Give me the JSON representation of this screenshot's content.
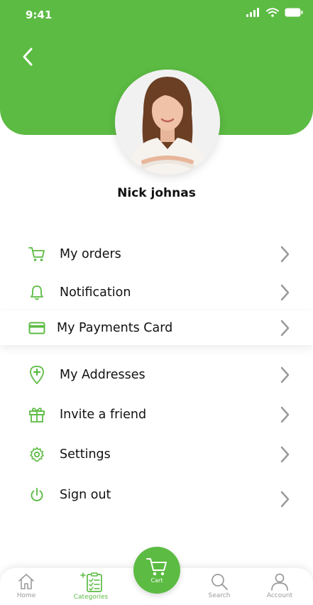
{
  "status_bar": {
    "time": "9:41"
  },
  "profile": {
    "name": "Nick johnas"
  },
  "menu": [
    {
      "label": "My orders",
      "icon": "cart-icon"
    },
    {
      "label": "Notification",
      "icon": "bell-icon"
    },
    {
      "label": "My Payments Card",
      "icon": "credit-card-icon"
    },
    {
      "label": "My Addresses",
      "icon": "location-pin-icon"
    },
    {
      "label": "Invite a friend",
      "icon": "gift-icon"
    },
    {
      "label": "Settings",
      "icon": "gear-icon"
    },
    {
      "label": "Sign out",
      "icon": "power-icon"
    }
  ],
  "bottom_nav": {
    "home": "Home",
    "categories": "Categories",
    "cart": "Cart",
    "search": "Search",
    "account": "Account"
  },
  "colors": {
    "accent": "#5cbb43",
    "chevron": "#9a9a9a",
    "inactive_nav": "#9a9a9a"
  }
}
